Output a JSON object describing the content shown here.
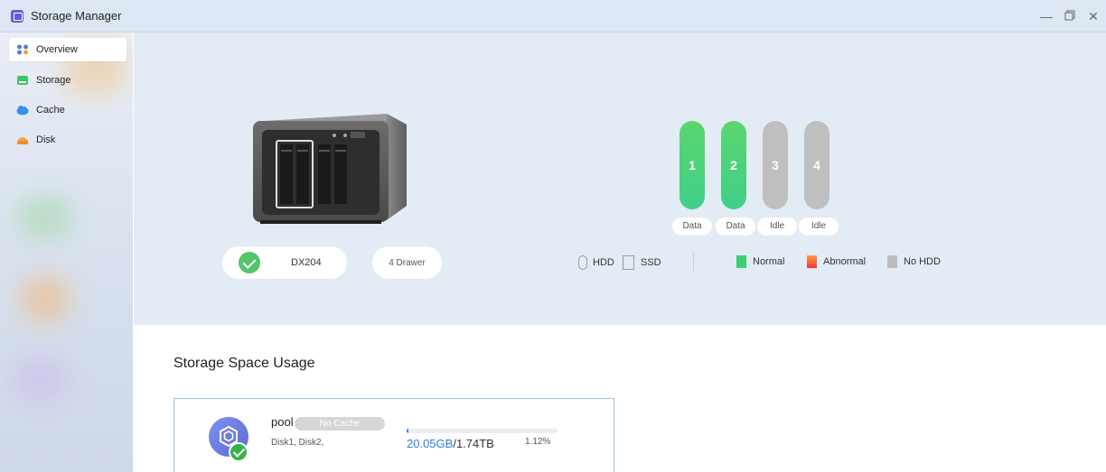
{
  "window": {
    "title": "Storage Manager"
  },
  "sidebar": {
    "items": [
      {
        "label": "Overview",
        "icon": "overview-icon",
        "active": true
      },
      {
        "label": "Storage",
        "icon": "storage-icon"
      },
      {
        "label": "Cache",
        "icon": "cache-icon"
      },
      {
        "label": "Disk",
        "icon": "disk-icon"
      }
    ]
  },
  "device": {
    "model": "DX204",
    "drawers": "4 Drawer",
    "status_icon": "check-icon"
  },
  "bays": [
    {
      "number": "1",
      "label": "Data",
      "state": "data"
    },
    {
      "number": "2",
      "label": "Data",
      "state": "data"
    },
    {
      "number": "3",
      "label": "Idle",
      "state": "idle"
    },
    {
      "number": "4",
      "label": "Idle",
      "state": "idle"
    }
  ],
  "legend": {
    "hdd": "HDD",
    "ssd": "SSD",
    "normal": "Normal",
    "abnormal": "Abnormal",
    "no_hdd": "No HDD"
  },
  "colors": {
    "normal": "#3ccf74",
    "abnormal_top": "#ff9a3c",
    "abnormal_bottom": "#ee3a3a",
    "no_hdd": "#bcbcbc",
    "accent": "#2c7be5"
  },
  "storage": {
    "section_title": "Storage Space Usage",
    "pool": {
      "name": "pool",
      "cache": "No Cache",
      "disks": "Disk1, Disk2,",
      "used": "20.05GB",
      "total": "/1.74TB",
      "percent": "1.12%",
      "percent_value": 1.12
    }
  }
}
